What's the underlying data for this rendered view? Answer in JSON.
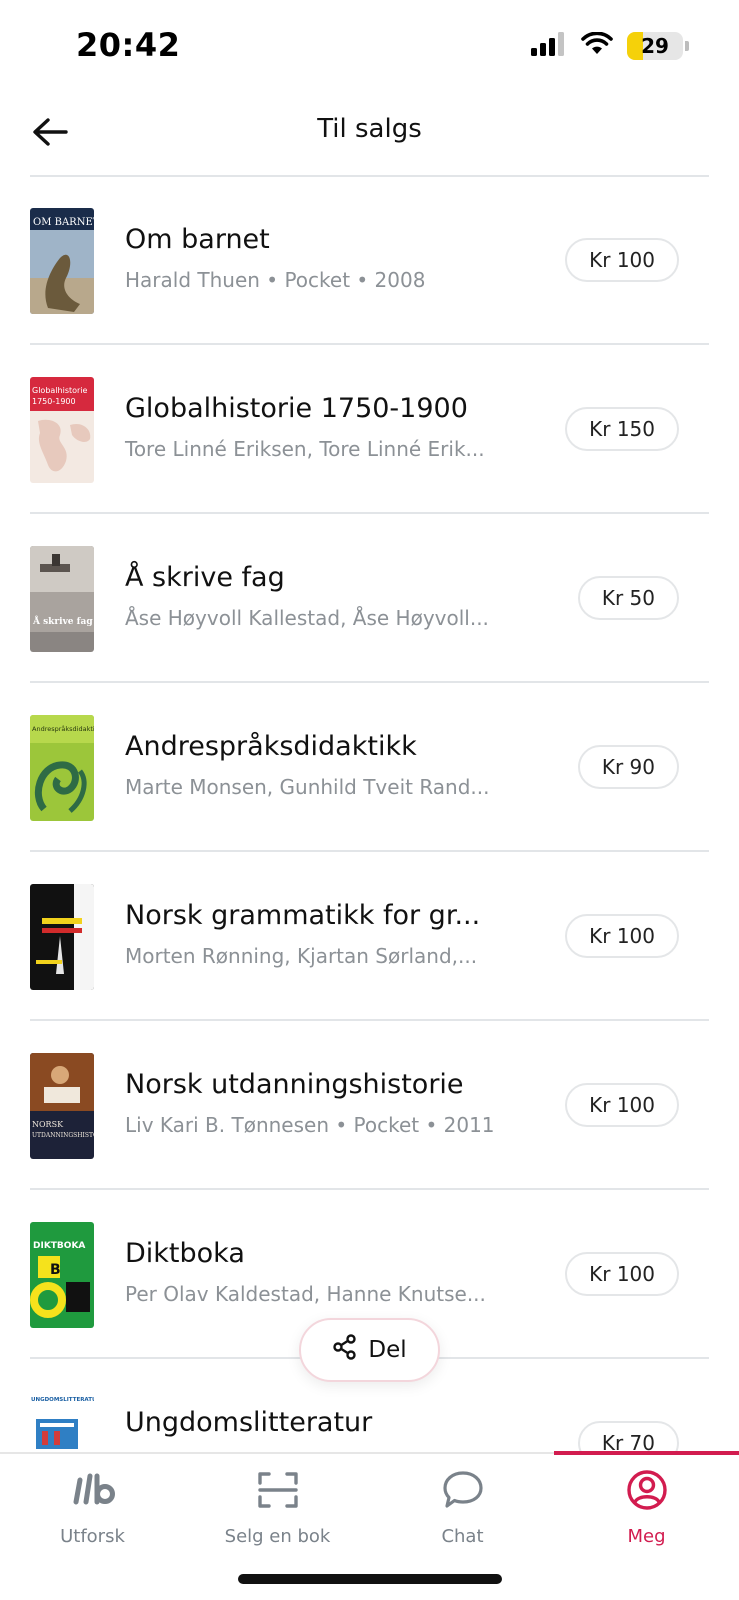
{
  "status": {
    "time": "20:42",
    "battery": "29",
    "battery_level": 0.29
  },
  "header": {
    "title": "Til salgs"
  },
  "books": [
    {
      "title": "Om barnet",
      "meta": "Harald Thuen • Pocket • 2008",
      "price": "Kr 100"
    },
    {
      "title": "Globalhistorie 1750-1900",
      "meta": "Tore Linné Eriksen, Tore Linné Erik...",
      "price": "Kr 150"
    },
    {
      "title": "Å skrive fag",
      "meta": "Åse Høyvoll Kallestad, Åse Høyvoll...",
      "price": "Kr 50"
    },
    {
      "title": "Andrespråksdidaktikk",
      "meta": "Marte Monsen, Gunhild Tveit Rand...",
      "price": "Kr 90"
    },
    {
      "title": "Norsk grammatikk for gr...",
      "meta": "Morten Rønning, Kjartan Sørland,...",
      "price": "Kr 100"
    },
    {
      "title": "Norsk utdanningshistorie",
      "meta": "Liv Kari B. Tønnesen • Pocket • 2011",
      "price": "Kr 100"
    },
    {
      "title": "Diktboka",
      "meta": "Per Olav Kaldestad, Hanne Knutse...",
      "price": "Kr 100"
    },
    {
      "title": "Ungdomslitteratur",
      "meta": "",
      "price": "Kr 70"
    }
  ],
  "share": {
    "label": "Del"
  },
  "tabs": [
    {
      "label": "Utforsk"
    },
    {
      "label": "Selg en bok"
    },
    {
      "label": "Chat"
    },
    {
      "label": "Meg"
    }
  ],
  "colors": {
    "accent": "#d21c4f",
    "muted": "#7a828a",
    "divider": "#e2e5e8"
  }
}
